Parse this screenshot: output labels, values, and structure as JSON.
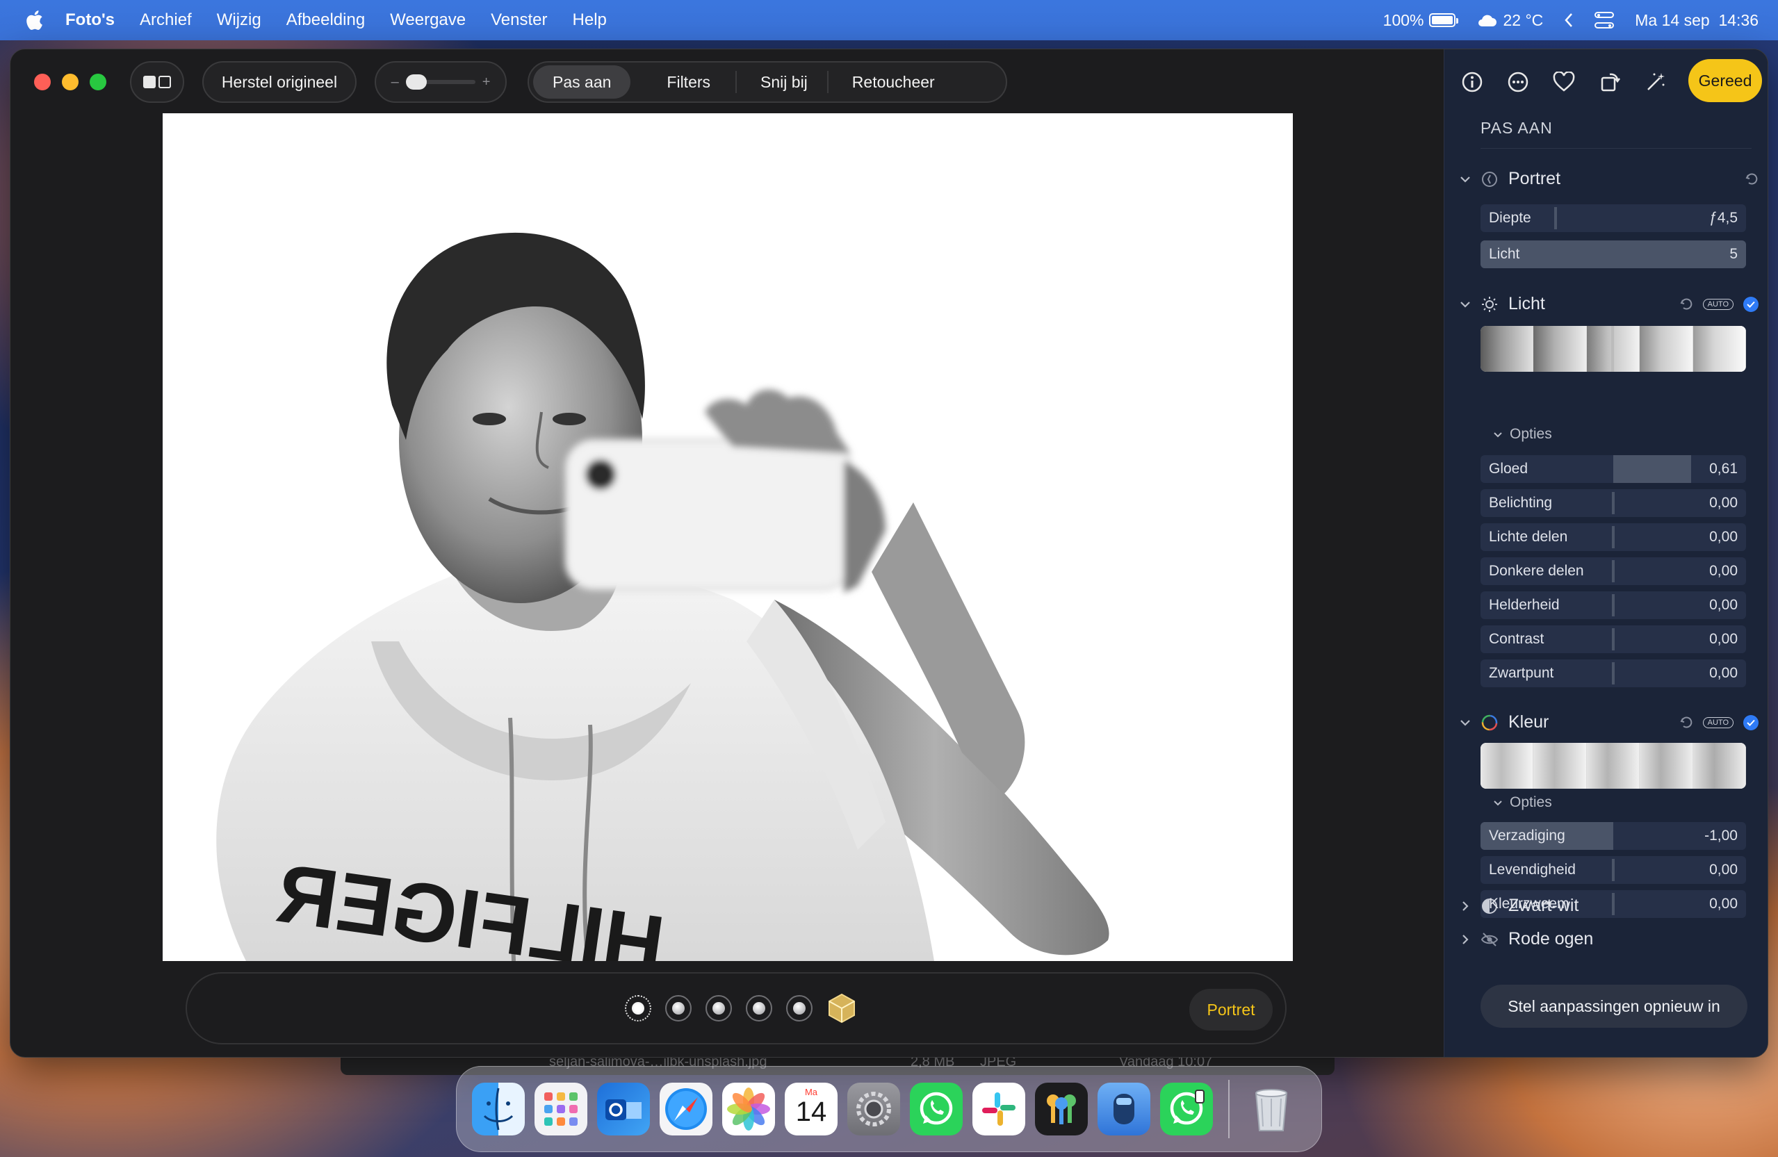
{
  "menubar": {
    "app_name": "Foto's",
    "items": [
      "Archief",
      "Wijzig",
      "Afbeelding",
      "Weergave",
      "Venster",
      "Help"
    ],
    "battery": "100%",
    "weather": "22 °C",
    "datetime": "Ma 14 sep  14:36"
  },
  "toolbar": {
    "revert_label": "Herstel origineel",
    "slider_minus": "–",
    "slider_plus": "+",
    "tabs": [
      "Pas aan",
      "Filters",
      "Snij bij",
      "Retoucheer"
    ],
    "active_tab": "Pas aan"
  },
  "photo": {
    "text_on_shirt": "HILFIGER"
  },
  "portrait_bar": {
    "mode_label": "Portret",
    "lighting_count": 6
  },
  "sidebar": {
    "done_label": "Gereed",
    "title": "PAS AAN",
    "sections": {
      "portret": {
        "label": "Portret",
        "rows": [
          {
            "label": "Diepte",
            "value": "ƒ4,5"
          },
          {
            "label": "Licht",
            "value": "5"
          }
        ]
      },
      "licht": {
        "label": "Licht",
        "auto": "AUTO",
        "opties": "Opties",
        "rows": [
          {
            "label": "Gloed",
            "value": "0,61"
          },
          {
            "label": "Belichting",
            "value": "0,00"
          },
          {
            "label": "Lichte delen",
            "value": "0,00"
          },
          {
            "label": "Donkere delen",
            "value": "0,00"
          },
          {
            "label": "Helderheid",
            "value": "0,00"
          },
          {
            "label": "Contrast",
            "value": "0,00"
          },
          {
            "label": "Zwartpunt",
            "value": "0,00"
          }
        ]
      },
      "kleur": {
        "label": "Kleur",
        "auto": "AUTO",
        "opties": "Opties",
        "rows": [
          {
            "label": "Verzadiging",
            "value": "-1,00"
          },
          {
            "label": "Levendigheid",
            "value": "0,00"
          },
          {
            "label": "Kleurzweem",
            "value": "0,00"
          }
        ]
      },
      "zwartwit": {
        "label": "Zwart-wit"
      },
      "rodeogen": {
        "label": "Rode ogen"
      }
    },
    "reset_label": "Stel aanpassingen opnieuw in"
  },
  "behind_window": {
    "filename": "seljan-salimova-…ilbk-unsplash.jpg",
    "size": "2,8 MB",
    "type": "JPEG",
    "date": "Vandaag 10:07"
  },
  "dock": {
    "calendar_month": "Ma",
    "calendar_day": "14",
    "apps": [
      "finder",
      "launchpad",
      "outlook",
      "safari",
      "photos",
      "calendar",
      "system-settings",
      "whatsapp",
      "slack",
      "keychain",
      "xcode-like",
      "whatsapp-business",
      "trash"
    ]
  },
  "colors": {
    "accent_yellow": "#f5c518",
    "menubar_blue": "#3b76de",
    "check_blue": "#2f7bf6"
  }
}
